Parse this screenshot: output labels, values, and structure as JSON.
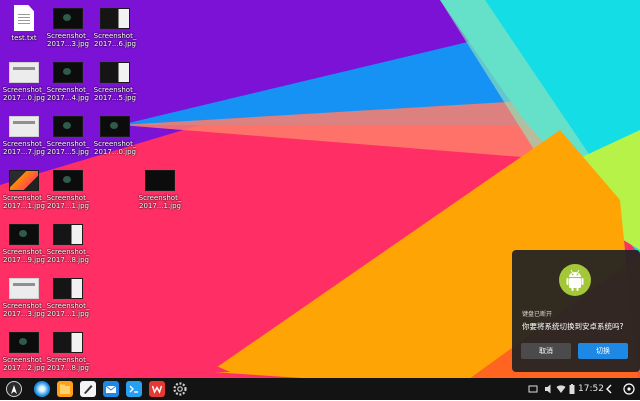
{
  "desktop": {
    "icons": [
      {
        "label1": "test.txt",
        "label2": "",
        "kind": "text-file-icon"
      },
      {
        "label1": "Screenshot_",
        "label2": "2017...3.jpg",
        "kind": "screenshot-thumbnail"
      },
      {
        "label1": "Screenshot_",
        "label2": "2017...6.jpg",
        "kind": "screenshot-thumbnail"
      },
      {
        "label1": "Screenshot_",
        "label2": "2017...0.jpg",
        "kind": "screenshot-thumbnail"
      },
      {
        "label1": "Screenshot_",
        "label2": "2017...4.jpg",
        "kind": "screenshot-thumbnail"
      },
      {
        "label1": "Screenshot_",
        "label2": "2017...5.jpg",
        "kind": "screenshot-thumbnail"
      },
      {
        "label1": "Screenshot_",
        "label2": "2017...7.jpg",
        "kind": "screenshot-thumbnail"
      },
      {
        "label1": "Screenshot_",
        "label2": "2017...5.jpg",
        "kind": "screenshot-thumbnail"
      },
      {
        "label1": "Screenshot_",
        "label2": "2017...0.jpg",
        "kind": "screenshot-thumbnail"
      },
      {
        "label1": "Screenshot_",
        "label2": "2017...1.jpg",
        "kind": "screenshot-thumbnail"
      },
      {
        "label1": "Screenshot_",
        "label2": "2017...1.jpg",
        "kind": "screenshot-thumbnail"
      },
      {
        "label1": "Screenshot_",
        "label2": "2017...1.jpg",
        "kind": "screenshot-thumbnail"
      },
      {
        "label1": "Screenshot_",
        "label2": "2017...9.jpg",
        "kind": "screenshot-thumbnail"
      },
      {
        "label1": "Screenshot_",
        "label2": "2017...8.jpg",
        "kind": "screenshot-thumbnail"
      },
      {
        "label1": "Screenshot_",
        "label2": "2017...3.jpg",
        "kind": "screenshot-thumbnail"
      },
      {
        "label1": "Screenshot_",
        "label2": "2017...1.jpg",
        "kind": "screenshot-thumbnail"
      },
      {
        "label1": "Screenshot_",
        "label2": "2017...2.jpg",
        "kind": "screenshot-thumbnail"
      },
      {
        "label1": "Screenshot_",
        "label2": "2017...8.jpg",
        "kind": "screenshot-thumbnail"
      }
    ]
  },
  "taskbar": {
    "apps": [
      "start-menu-icon",
      "browser-icon",
      "file-manager-icon",
      "notes-icon",
      "mail-icon",
      "terminal-icon",
      "wps-office-icon",
      "settings-icon"
    ],
    "tray_icons": [
      "keyboard-icon",
      "volume-icon",
      "wifi-icon",
      "battery-icon"
    ],
    "clock": "17:52"
  },
  "dialog": {
    "title": "键盘已断开",
    "message": "你要将系统切换到安卓系统吗?",
    "cancel_label": "取消",
    "switch_label": "切换",
    "icon": "android-icon"
  },
  "colors": {
    "wallpaper_purple": "#7c12d6",
    "wallpaper_pink": "#ff2f66",
    "wallpaper_orange": "#ffa405",
    "wallpaper_cyan": "#15dde6",
    "wallpaper_blue": "#1592f4",
    "taskbar": "#131313",
    "dialog_button": "#1e88e5",
    "android_green": "#a4c639"
  }
}
